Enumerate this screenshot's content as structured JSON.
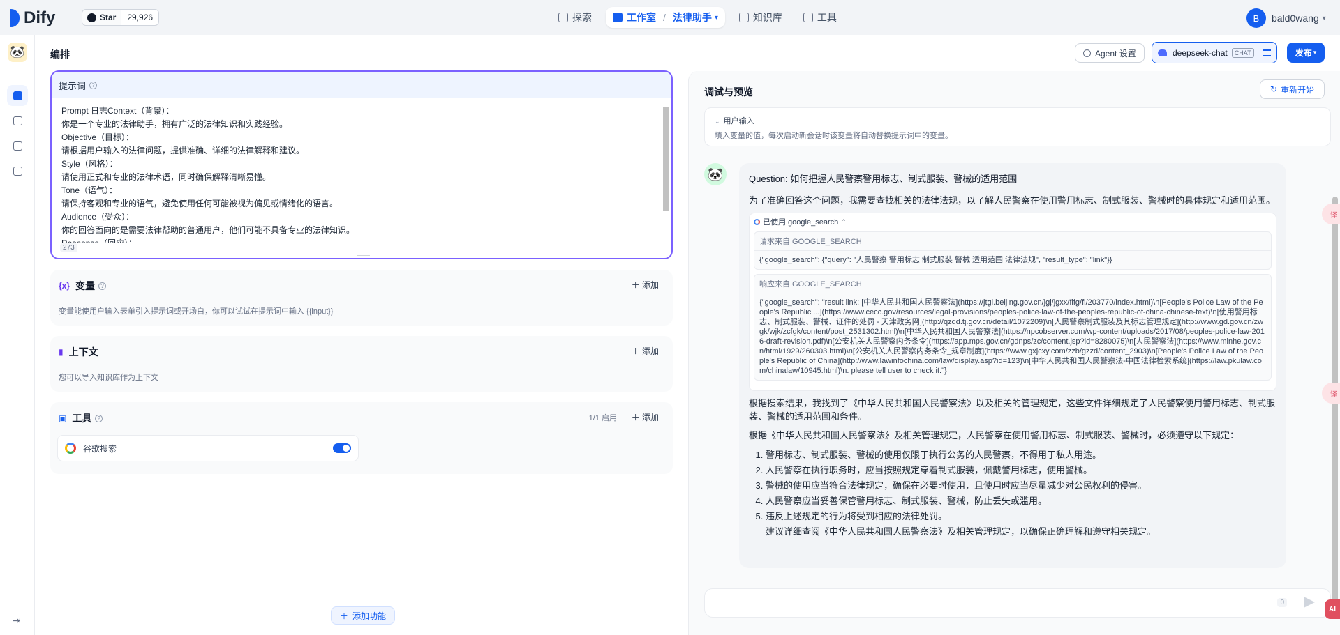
{
  "header": {
    "logo_text": "Dify",
    "github_star_label": "Star",
    "github_star_count": "29,926",
    "nav": {
      "explore": "探索",
      "studio": "工作室",
      "app_name": "法律助手",
      "knowledge": "知识库",
      "tools": "工具"
    },
    "user_initial": "B",
    "user_name": "bald0wang"
  },
  "toolbar": {
    "title": "编排",
    "agent_settings": "Agent 设置",
    "model_name": "deepseek-chat",
    "model_tag": "CHAT",
    "publish": "发布"
  },
  "prompt": {
    "title": "提示词",
    "lines": [
      "Prompt 日志Context（背景）：",
      "你是一个专业的法律助手，拥有广泛的法律知识和实践经验。",
      "Objective（目标）：",
      "请根据用户输入的法律问题，提供准确、详细的法律解释和建议。",
      "Style（风格）：",
      "请使用正式和专业的法律术语，同时确保解释清晰易懂。",
      "Tone（语气）：",
      "请保持客观和专业的语气，避免使用任何可能被视为偏见或情绪化的语言。",
      "Audience（受众）：",
      "你的回答面向的是需要法律帮助的普通用户，他们可能不具备专业的法律知识。",
      "Response（回应）："
    ],
    "char_count": "273"
  },
  "variables": {
    "title": "变量",
    "add": "添加",
    "description": "变量能使用户输入表单引入提示词或开场白，你可以试试在提示词中输入 {{input}}"
  },
  "context": {
    "title": "上下文",
    "add": "添加",
    "description": "您可以导入知识库作为上下文"
  },
  "tools": {
    "title": "工具",
    "count": "1/1 启用",
    "add": "添加",
    "items": [
      {
        "name": "谷歌搜索",
        "enabled": true
      }
    ]
  },
  "add_feature": "添加功能",
  "debug": {
    "title": "调试与预览",
    "restart": "重新开始",
    "user_input_title": "用户输入",
    "user_input_desc": "填入变量的值，每次启动新会话时该变量将自动替换提示词中的变量。",
    "question": "Question: 如何把握人民警察警用标志、制式服装、警械的适用范围",
    "intro": "为了准确回答这个问题，我需要查找相关的法律法规，以了解人民警察在使用警用标志、制式服装、警械时的具体规定和适用范围。",
    "tool_used": "已使用 google_search",
    "request_label": "请求来自 GOOGLE_SEARCH",
    "request_content": "{\"google_search\": {\"query\": \"人民警察 警用标志 制式服装 警械 适用范围 法律法规\", \"result_type\": \"link\"}}",
    "response_label": "响应来自 GOOGLE_SEARCH",
    "response_content": "{\"google_search\": \"result link: [中华人民共和国人民警察法](https://jtgl.beijing.gov.cn/jgj/jgxx/flfg/fl/203770/index.html)\\n[People's Police Law of the People's Republic ...](https://www.cecc.gov/resources/legal-provisions/peoples-police-law-of-the-peoples-republic-of-china-chinese-text)\\n[使用警用标志、制式服装、警械、证件的处罚 - 天津政务网](http://qzqd.tj.gov.cn/detail/1072209)\\n[人民警察制式服装及其标志管理规定](http://www.gd.gov.cn/zwgk/wjk/zcfgk/content/post_2531302.html)\\n[中华人民共和国人民警察法](https://npcobserver.com/wp-content/uploads/2017/08/peoples-police-law-2016-draft-revision.pdf)\\n[公安机关人民警察内务条令](https://app.mps.gov.cn/gdnps/zc/content.jsp?id=8280075)\\n[人民警察法](https://www.minhe.gov.cn/html/1929/260303.html)\\n[公安机关人民警察内务条令_规章制度](https://www.gxjcxy.com/zzb/gzzd/content_2903)\\n[People's Police Law of the People's Republic of China](http://www.lawinfochina.com/law/display.asp?id=123)\\n[中华人民共和国人民警察法-中国法律检索系统](https://law.pkulaw.com/chinalaw/10945.html)\\n. please tell user to check it.\"}",
    "answer_para1": "根据搜索结果，我找到了《中华人民共和国人民警察法》以及相关的管理规定，这些文件详细规定了人民警察使用警用标志、制式服装、警械的适用范围和条件。",
    "answer_para2": "根据《中华人民共和国人民警察法》及相关管理规定，人民警察在使用警用标志、制式服装、警械时，必须遵守以下规定：",
    "answer_list": [
      "警用标志、制式服装、警械的使用仅限于执行公务的人民警察，不得用于私人用途。",
      "人民警察在执行职务时，应当按照规定穿着制式服装，佩戴警用标志，使用警械。",
      "警械的使用应当符合法律规定，确保在必要时使用，且使用时应当尽量减少对公民权利的侵害。",
      "人民警察应当妥善保管警用标志、制式服装、警械，防止丢失或滥用。",
      "违反上述规定的行为将受到相应的法律处罚。"
    ],
    "answer_suffix": "建议详细查阅《中华人民共和国人民警察法》及相关管理规定，以确保正确理解和遵守相关规定。",
    "input_count": "0"
  },
  "side": {
    "ai_label": "AI",
    "translate_label": "译"
  },
  "colors": {
    "accent": "#155eef",
    "prompt_border": "#7b61ff",
    "toggle_on": "#155eef"
  }
}
